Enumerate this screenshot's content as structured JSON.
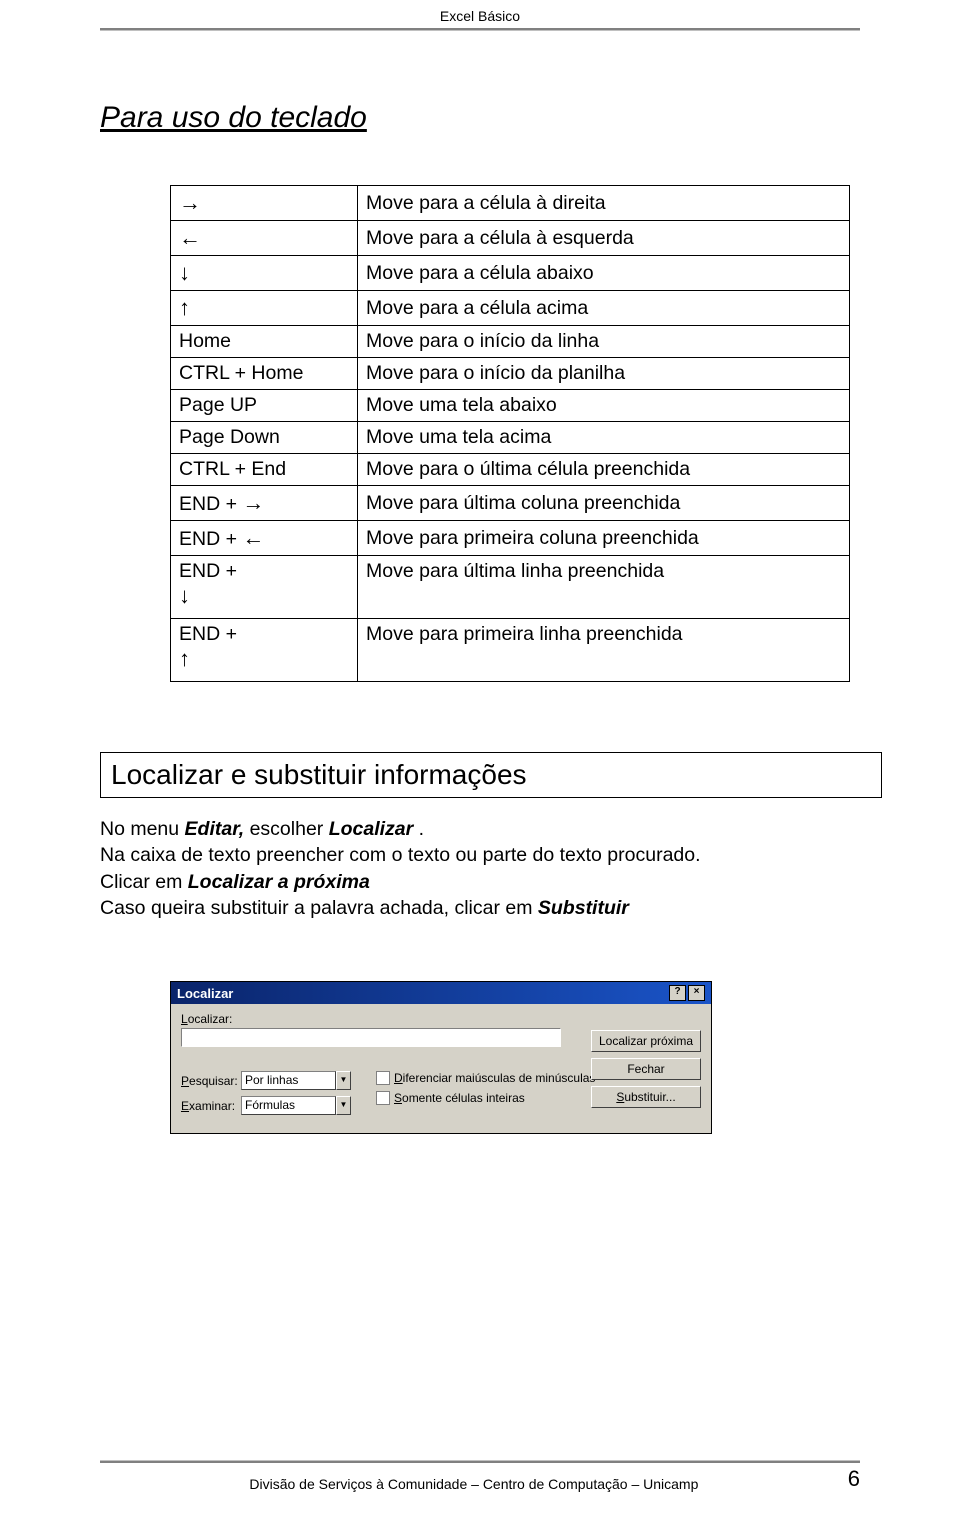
{
  "doc_header": "Excel Básico",
  "section1_title": "Para uso do teclado",
  "table": [
    {
      "key": "→",
      "is_arrow": true,
      "desc": "Move para a célula à direita"
    },
    {
      "key": "←",
      "is_arrow": true,
      "desc": "Move para a célula à esquerda"
    },
    {
      "key": "↓",
      "is_arrow": true,
      "desc": "Move para a célula abaixo"
    },
    {
      "key": "↑",
      "is_arrow": true,
      "desc": "Move para a célula acima"
    },
    {
      "key": "Home",
      "desc": "Move para o início da linha"
    },
    {
      "key": "CTRL + Home",
      "desc": "Move para o início da planilha"
    },
    {
      "key": "Page UP",
      "desc": "Move uma tela abaixo"
    },
    {
      "key": "Page Down",
      "desc": "Move uma tela acima"
    },
    {
      "key": "CTRL + End",
      "desc": "Move para o última célula preenchida"
    },
    {
      "key_html": "END + <span class='arrow'>→</span>",
      "desc": "Move para última coluna preenchida"
    },
    {
      "key_html": "END + <span class='arrow'>←</span>",
      "desc": "Move para primeira coluna preenchida"
    },
    {
      "key_html": "END +<br><span class='arrow'>↓</span>",
      "tall": true,
      "desc": "Move para última linha preenchida"
    },
    {
      "key_html": "END +<br><span class='arrow'>↑</span>",
      "tall": true,
      "desc": "Move para primeira linha preenchida"
    }
  ],
  "section2_title": "Localizar e substituir informações",
  "para": {
    "line1_pre": "No menu ",
    "line1_b1": "Editar,",
    "line1_mid": "  escolher ",
    "line1_b2": "Localizar",
    "line1_post": " .",
    "line2": "Na caixa de texto preencher com o texto ou parte do texto procurado.",
    "line3_pre": "Clicar em ",
    "line3_b": " Localizar a próxima",
    "line4_pre": "Caso queira substituir a palavra achada, clicar em ",
    "line4_b": "Substituir"
  },
  "dialog": {
    "title": "Localizar",
    "help_icon": "?",
    "close_icon": "×",
    "label_localizar": "Localizar:",
    "label_pesquisar": "Pesquisar:",
    "sel_pesquisar": "Por linhas",
    "label_examinar": "Examinar:",
    "sel_examinar": "Fórmulas",
    "chk1_u": "D",
    "chk1_rest": "iferenciar maiúsculas de minúsculas",
    "chk2_u": "S",
    "chk2_rest": "omente células inteiras",
    "btn1": "Localizar próxima",
    "btn2": "Fechar",
    "btn3": "Substituir..."
  },
  "footer_text": "Divisão de Serviços à Comunidade – Centro de Computação – Unicamp",
  "page_number": "6"
}
